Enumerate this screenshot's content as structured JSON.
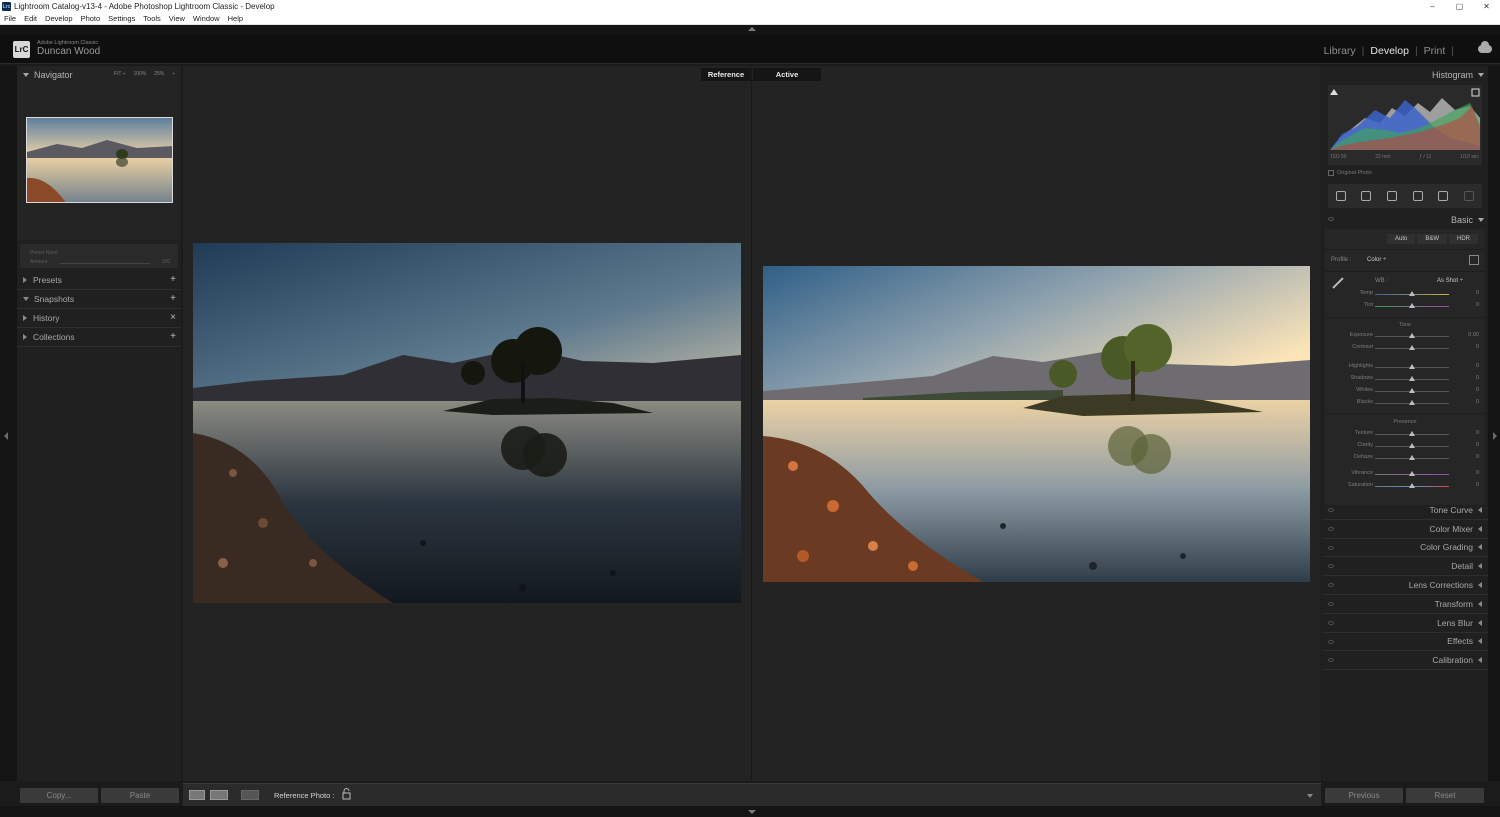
{
  "window": {
    "title": "Lightroom Catalog-v13-4 - Adobe Photoshop Lightroom Classic - Develop",
    "app_icon": "Lrc",
    "controls": [
      "–",
      "▢",
      "✕"
    ]
  },
  "menubar": [
    "File",
    "Edit",
    "Develop",
    "Photo",
    "Settings",
    "Tools",
    "View",
    "Window",
    "Help"
  ],
  "identity": {
    "logo": "LrC",
    "app_name": "Adobe Lightroom Classic",
    "user": "Duncan Wood",
    "modules": [
      "Library",
      "Develop",
      "Print"
    ],
    "active_module": "Develop"
  },
  "left": {
    "navigator": {
      "title": "Navigator",
      "zoom_options": [
        "FIT ÷",
        "100%",
        "25%",
        "÷"
      ]
    },
    "preset_box": {
      "line1": "Preset   None",
      "line2": "Amount",
      "line2_value": "100"
    },
    "sections": [
      {
        "label": "Presets",
        "action": "+"
      },
      {
        "label": "Snapshots",
        "action": "+"
      },
      {
        "label": "History",
        "action": "×"
      },
      {
        "label": "Collections",
        "action": "+"
      }
    ],
    "copy_label": "Copy...",
    "paste_label": "Paste"
  },
  "center": {
    "tab_reference": "Reference",
    "tab_active": "Active",
    "toolbar_label": "Reference Photo :"
  },
  "right": {
    "histogram": {
      "title": "Histogram",
      "meta": [
        "ISO 50",
        "22 mm",
        "ƒ / 11",
        "1/10 sec"
      ],
      "original_photo": "Original Photo"
    },
    "basic": {
      "title": "Basic",
      "treatments": [
        "Auto",
        "B&W",
        "HDR"
      ],
      "profile_label": "Profile :",
      "profile_value": "Color ÷",
      "wb_label": "WB :",
      "wb_value": "As Shot ÷",
      "wb_sliders": [
        {
          "name": "Temp",
          "value": "0"
        },
        {
          "name": "Tint",
          "value": "0"
        }
      ],
      "tone_label": "Tone",
      "tone_sliders": [
        {
          "name": "Exposure",
          "value": "0.00"
        },
        {
          "name": "Contrast",
          "value": "0"
        },
        {
          "name": "Highlights",
          "value": "0"
        },
        {
          "name": "Shadows",
          "value": "0"
        },
        {
          "name": "Whites",
          "value": "0"
        },
        {
          "name": "Blacks",
          "value": "0"
        }
      ],
      "presence_label": "Presence",
      "presence_sliders": [
        {
          "name": "Texture",
          "value": "0"
        },
        {
          "name": "Clarity",
          "value": "0"
        },
        {
          "name": "Dehaze",
          "value": "0"
        },
        {
          "name": "Vibrance",
          "value": "0"
        },
        {
          "name": "Saturation",
          "value": "0"
        }
      ]
    },
    "sections": [
      "Tone Curve",
      "Color Mixer",
      "Color Grading",
      "Detail",
      "Lens Corrections",
      "Transform",
      "Lens Blur",
      "Effects",
      "Calibration"
    ],
    "previous_label": "Previous",
    "reset_label": "Reset"
  }
}
